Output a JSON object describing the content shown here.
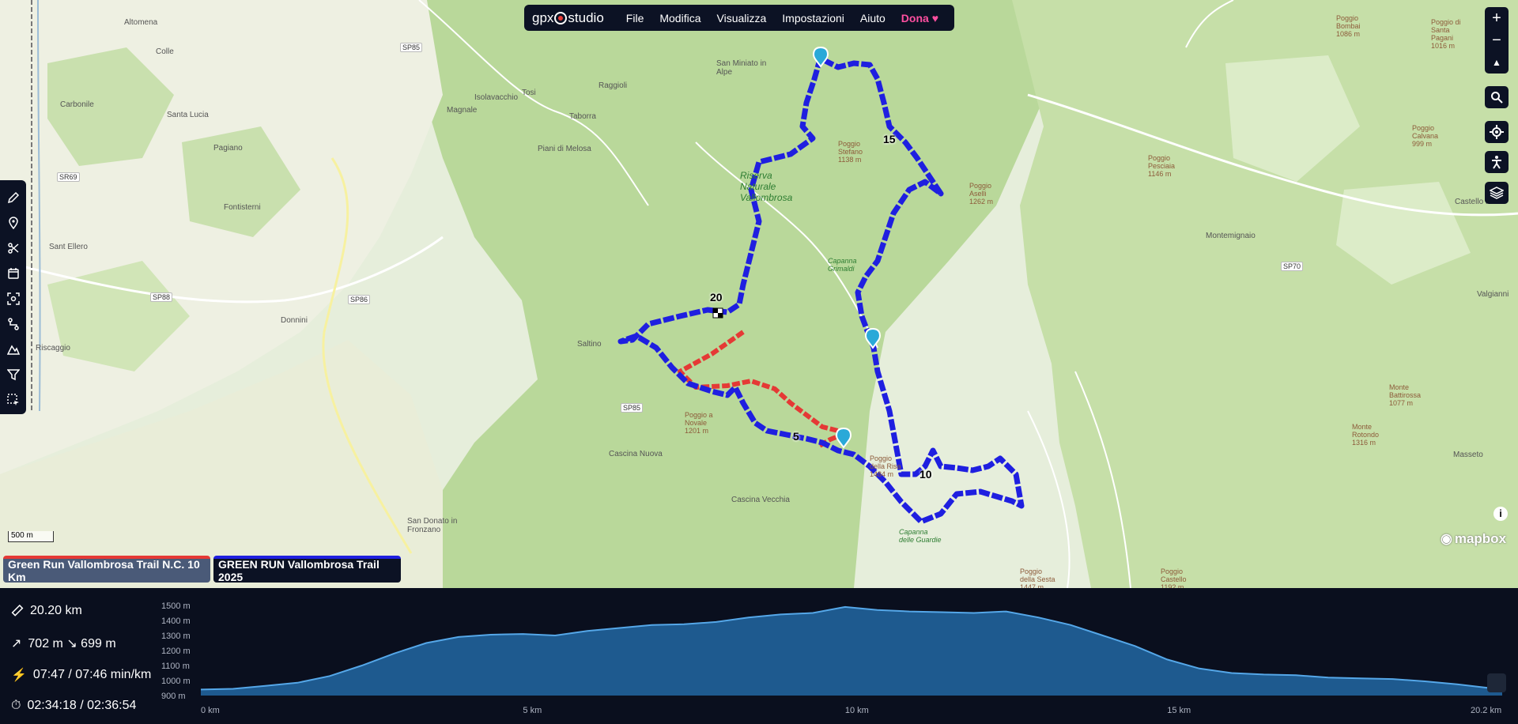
{
  "app": {
    "logo_left": "gpx",
    "logo_right": "studio"
  },
  "menu": {
    "items": [
      "File",
      "Modifica",
      "Visualizza",
      "Impostazioni",
      "Aiuto"
    ],
    "donate": "Dona"
  },
  "map": {
    "labels": [
      "Altomena",
      "Colle",
      "Carbonile",
      "Santa Lucia",
      "Pagiano",
      "Fontisterni",
      "Sant Ellero",
      "Donnini",
      "Riscaggio",
      "Saltino",
      "San Donato in Fronzano",
      "Cascina Nuova",
      "Cascina Vecchia",
      "Magnale",
      "Tosi",
      "Taborra",
      "Piani di Melosa",
      "Isolavacchio",
      "Raggioli",
      "San Miniato in Alpe",
      "Masseto",
      "Castello Prato",
      "Montemignaio",
      "Valgianni"
    ],
    "green_labels": [
      "Riserva Naturale Vallombrosa",
      "Capanna Grimaldi",
      "Capanna delle Guardie"
    ],
    "peaks": [
      "Poggio Stefano 1138 m",
      "Poggio Aselli 1262 m",
      "Poggio Pesciaia 1146 m",
      "Poggio Calvana 999 m",
      "Poggio Bombai 1086 m",
      "Monte Rotondo 1316 m",
      "Monte Battirossa 1077 m",
      "Poggio a Novale 1201 m",
      "Poggio della Risa 1484 m",
      "Poggio della Sesta 1447 m",
      "Poggio Castello 1192 m",
      "Poggio di Santa Pagani 1016 m"
    ],
    "roads": [
      "SP85",
      "SR69",
      "SP88",
      "SP86",
      "SP85",
      "SP70"
    ],
    "km_markers": [
      "20",
      "15",
      "10",
      "5"
    ],
    "scale": "500 m",
    "attribution": "mapbox",
    "track_colors": {
      "blue": "#1f1fe0",
      "red": "#e53935"
    }
  },
  "tracks": [
    {
      "name": "Green Run Vallombrosa Trail N.C. 10 Km",
      "color": "#e53935"
    },
    {
      "name": "GREEN RUN Vallombrosa Trail 2025",
      "color": "#1f1fe0"
    }
  ],
  "stats": {
    "distance": "20.20 km",
    "elevation": "702 m ↘ 699 m",
    "pace": "07:47 / 07:46 min/km",
    "time": "02:34:18 / 02:36:54"
  },
  "chart_data": {
    "type": "area",
    "x_ticks": [
      "0 km",
      "5 km",
      "10 km",
      "15 km",
      "20.2 km"
    ],
    "y_ticks": [
      "1500 m",
      "1400 m",
      "1300 m",
      "1200 m",
      "1100 m",
      "1000 m",
      "900 m"
    ],
    "ylim": [
      900,
      1500
    ],
    "xlim": [
      0,
      20.2
    ],
    "x": [
      0,
      0.5,
      1,
      1.5,
      2,
      2.5,
      3,
      3.5,
      4,
      4.5,
      5,
      5.5,
      6,
      6.5,
      7,
      7.5,
      8,
      8.5,
      9,
      9.5,
      10,
      10.5,
      11,
      11.5,
      12,
      12.5,
      13,
      13.5,
      14,
      14.5,
      15,
      15.5,
      16,
      16.5,
      17,
      17.5,
      18,
      18.5,
      19,
      19.5,
      20,
      20.2
    ],
    "y": [
      940,
      945,
      965,
      985,
      1030,
      1100,
      1180,
      1250,
      1290,
      1305,
      1310,
      1300,
      1330,
      1350,
      1370,
      1375,
      1390,
      1420,
      1440,
      1450,
      1490,
      1470,
      1460,
      1455,
      1450,
      1460,
      1420,
      1370,
      1300,
      1230,
      1140,
      1080,
      1050,
      1040,
      1035,
      1020,
      1015,
      1010,
      995,
      975,
      950,
      945
    ]
  }
}
